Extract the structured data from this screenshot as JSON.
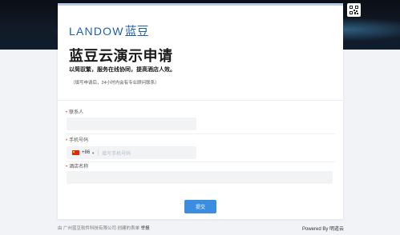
{
  "brand": {
    "logo_latin": "LANDOW",
    "logo_cn": "蓝豆"
  },
  "form": {
    "title": "蓝豆云演示申请",
    "subtitle": "以简驭繁，服务在线协同，提高酒店人效。",
    "note": "（填写申请后，24小时内会有专业顾问联系）",
    "fields": [
      {
        "label": "联系人",
        "required_mark": "•"
      },
      {
        "label": "手机号码",
        "required_mark": "•",
        "country_code": "+86",
        "placeholder": "填写手机号码"
      },
      {
        "label": "酒店名称",
        "required_mark": "•"
      }
    ],
    "submit_label": "提交"
  },
  "footer": {
    "left_text": "由 广州蓝豆软件科技有限公司 创建的表单",
    "report_label": "举报",
    "right_text": "Powered By 明道云"
  },
  "colors": {
    "accent": "#3b8de0",
    "brand": "#1f5fa8",
    "card_top_border": "#b7cde9"
  },
  "icons": {
    "qr": "qr-code-icon",
    "flag": "china-flag-icon"
  }
}
